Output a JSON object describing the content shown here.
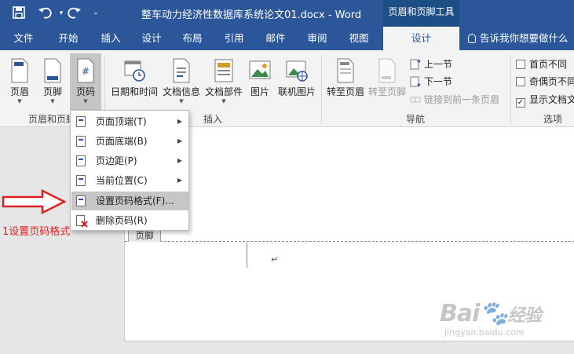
{
  "titlebar": {
    "save_icon": "save-icon",
    "undo_icon": "undo-icon",
    "redo_icon": "redo-icon",
    "customize_icon": "customize-qat-icon",
    "title": "整车动力经济性数据库系统论文01.docx - Word",
    "context_title": "页眉和页脚工具"
  },
  "tabs": {
    "file": "文件",
    "home": "开始",
    "insert": "插入",
    "design_doc": "设计",
    "layout": "布局",
    "references": "引用",
    "mailings": "邮件",
    "review": "审阅",
    "view": "视图",
    "hf_design": "设计",
    "tell_me": "告诉我你想要做什么"
  },
  "ribbon": {
    "header_btn": "页眉",
    "footer_btn": "页脚",
    "page_number_btn": "页码",
    "group_hf": "页眉和页脚",
    "datetime_btn": "日期和时间",
    "docinfo_btn": "文档信息",
    "quickparts_btn": "文档部件",
    "picture_btn": "图片",
    "online_picture_btn": "联机图片",
    "group_insert": "插入",
    "goto_header_btn": "转至页眉",
    "goto_footer_btn": "转至页脚",
    "previous_btn": "上一节",
    "next_btn": "下一节",
    "link_previous_btn": "链接到前一条页眉",
    "group_nav": "导航",
    "different_first": "首页不同",
    "different_oddeven": "奇偶页不同",
    "show_doc_text": "显示文档文",
    "group_options": "选项"
  },
  "menu": {
    "items": [
      {
        "label": "页面顶端(T)",
        "submenu": true
      },
      {
        "label": "页面底端(B)",
        "submenu": true
      },
      {
        "label": "页边距(P)",
        "submenu": true
      },
      {
        "label": "当前位置(C)",
        "submenu": true
      },
      {
        "label": "设置页码格式(F)...",
        "submenu": false
      },
      {
        "label": "删除页码(R)",
        "submenu": false
      }
    ],
    "highlighted_index": 4
  },
  "document": {
    "footer_tag": "页脚",
    "paragraph_mark": "↵"
  },
  "annotation": {
    "text": "1设置页码格式",
    "color": "#e02020"
  },
  "watermark": {
    "brand": "Bai",
    "brand_tail": "经验",
    "url": "jingyan.baidu.com"
  },
  "colors": {
    "accent": "#2b579a",
    "context_tab": "#1e4e86"
  }
}
